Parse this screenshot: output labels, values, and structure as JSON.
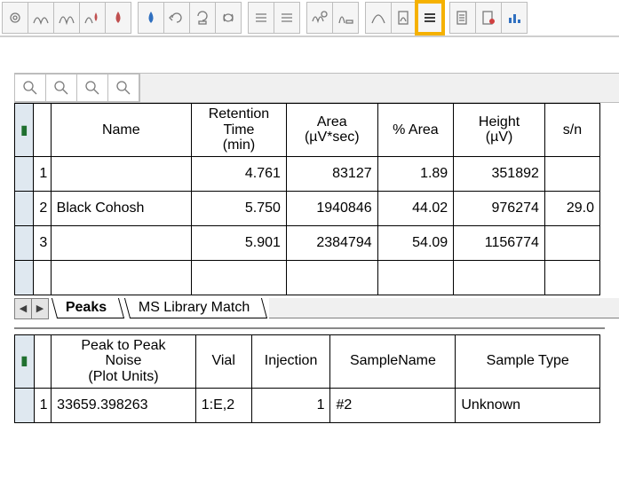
{
  "toolbar": {
    "buttons": [
      {
        "name": "settings-icon",
        "glyph": "⚙"
      },
      {
        "name": "peak-icon-1",
        "glyph": "∿"
      },
      {
        "name": "peak-icon-2",
        "glyph": "∿"
      },
      {
        "name": "peak-drop-icon",
        "glyph": "∿"
      },
      {
        "name": "drop-icon",
        "glyph": "💧"
      },
      {
        "name": "sep"
      },
      {
        "name": "blue-drop-icon",
        "glyph": "💧"
      },
      {
        "name": "refresh-icon",
        "glyph": "↻"
      },
      {
        "name": "refresh-down-icon",
        "glyph": "↻"
      },
      {
        "name": "recycle-icon",
        "glyph": "♻"
      },
      {
        "name": "sep"
      },
      {
        "name": "rows-icon",
        "glyph": "≣"
      },
      {
        "name": "rows-icon-2",
        "glyph": "≣"
      },
      {
        "name": "sep"
      },
      {
        "name": "wave-settings-icon",
        "glyph": "∿"
      },
      {
        "name": "spectrum-icon",
        "glyph": "⌇"
      },
      {
        "name": "sep"
      },
      {
        "name": "single-peak-icon",
        "glyph": "⌒"
      },
      {
        "name": "page-peak-icon",
        "glyph": "🗎"
      },
      {
        "name": "results-icon",
        "glyph": "≡",
        "highlight": true
      },
      {
        "name": "sep"
      },
      {
        "name": "library-icon",
        "glyph": "🗎"
      },
      {
        "name": "report-icon",
        "glyph": "🗎"
      },
      {
        "name": "chart-icon",
        "glyph": "📊"
      }
    ]
  },
  "mini_toolbar": {
    "icons": [
      "zoom-icon-1",
      "zoom-icon-2",
      "zoom-icon-3",
      "zoom-icon-4"
    ],
    "glyph": "🔍"
  },
  "peaks_table": {
    "headers": [
      "Name",
      "Retention\nTime\n(min)",
      "Area\n(µV*sec)",
      "% Area",
      "Height\n(µV)",
      "s/n"
    ],
    "rows": [
      {
        "idx": "1",
        "name": "",
        "rt": "4.761",
        "area": "83127",
        "pct": "1.89",
        "height": "351892",
        "sn": ""
      },
      {
        "idx": "2",
        "name": "Black Cohosh",
        "rt": "5.750",
        "area": "1940846",
        "pct": "44.02",
        "height": "976274",
        "sn": "29.0"
      },
      {
        "idx": "3",
        "name": "",
        "rt": "5.901",
        "area": "2384794",
        "pct": "54.09",
        "height": "1156774",
        "sn": ""
      }
    ]
  },
  "tabs": {
    "active": "Peaks",
    "other": "MS Library Match"
  },
  "noise_table": {
    "headers": [
      "Peak to Peak\nNoise\n(Plot Units)",
      "Vial",
      "Injection",
      "SampleName",
      "Sample Type"
    ],
    "rows": [
      {
        "idx": "1",
        "noise": "33659.398263",
        "vial": "1:E,2",
        "inj": "1",
        "sample": "#2",
        "type": "Unknown"
      }
    ]
  }
}
